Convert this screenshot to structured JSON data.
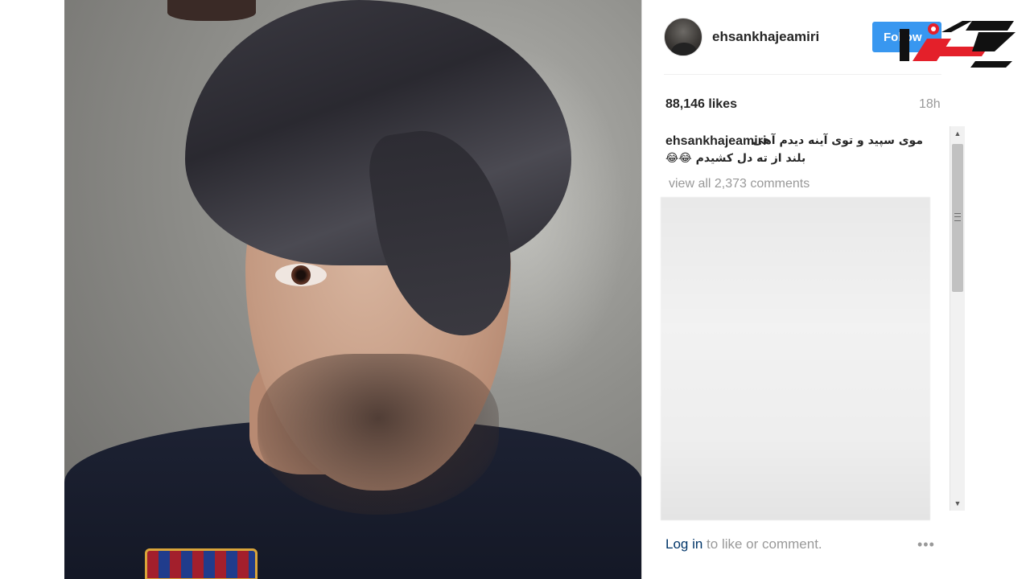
{
  "post": {
    "username": "ehsankhajeamiri",
    "follow_label": "Follow",
    "likes": "88,146 likes",
    "time_ago": "18h",
    "caption": {
      "user": "ehsankhajeamiri",
      "line1": "موی سپید و توی آینه دیدم آهی",
      "line2": "بلند از ته دل کشیدم 😂😂"
    },
    "view_all_comments": "view all 2,373 comments",
    "footer": {
      "login_link": "Log in",
      "login_rest": " to like or comment.",
      "more": "•••"
    }
  },
  "icons": {
    "more": "more-options-icon",
    "scroll_up": "scroll-up-arrow-icon",
    "scroll_down": "scroll-down-arrow-icon"
  },
  "colors": {
    "follow_button": "#3897f0",
    "link": "#003569",
    "muted": "#999999",
    "logo_red": "#e4202a"
  }
}
